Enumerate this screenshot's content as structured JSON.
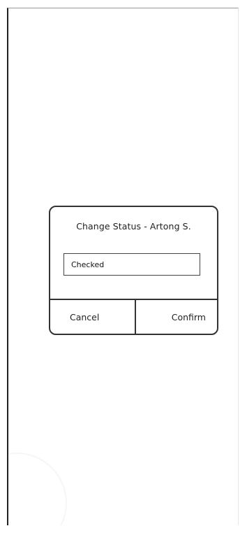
{
  "dialog": {
    "title": "Change Status - Artong S.",
    "status_value": "Checked",
    "cancel_label": "Cancel",
    "confirm_label": "Confirm"
  }
}
